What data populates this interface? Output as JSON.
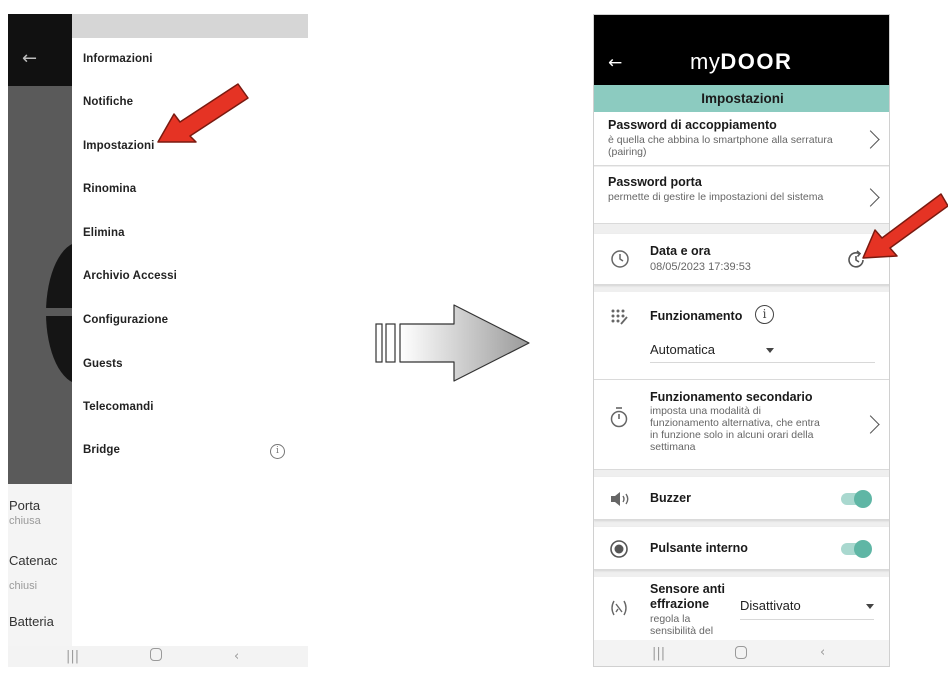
{
  "left_phone": {
    "drawer_items": [
      {
        "label": "Informazioni"
      },
      {
        "label": "Notifiche"
      },
      {
        "label": "Impostazioni"
      },
      {
        "label": "Rinomina"
      },
      {
        "label": "Elimina"
      },
      {
        "label": "Archivio Accessi"
      },
      {
        "label": "Configurazione"
      },
      {
        "label": "Guests"
      },
      {
        "label": "Telecomandi"
      },
      {
        "label": "Bridge"
      }
    ],
    "info_icon": "info-icon",
    "background_status": {
      "porta_label": "Porta",
      "porta_value": "chiusa",
      "catenacci_label": "Catenac",
      "catenacci_value": "chiusi",
      "batteria_label": "Batteria"
    }
  },
  "right_phone": {
    "logo_prefix": "my",
    "logo_main": "DOOR",
    "page_title": "Impostazioni",
    "pairing_password": {
      "title": "Password di accoppiamento",
      "subtitle": "è quella che abbina lo smartphone alla serratura (pairing)"
    },
    "door_password": {
      "title": "Password porta",
      "subtitle": "permette di gestire le impostazioni del sistema"
    },
    "date_time": {
      "title": "Data e ora",
      "value": "08/05/2023 17:39:53"
    },
    "operation": {
      "title": "Funzionamento",
      "selected": "Automatica"
    },
    "secondary_operation": {
      "title": "Funzionamento secondario",
      "subtitle": "imposta una modalità di funzionamento alternativa, che entra in funzione solo in alcuni orari della settimana"
    },
    "buzzer": {
      "title": "Buzzer",
      "enabled": true
    },
    "internal_button": {
      "title": "Pulsante interno",
      "enabled": true
    },
    "tamper_sensor": {
      "title_line1": "Sensore anti",
      "title_line2": "effrazione",
      "subtitle_line1": "regola la",
      "subtitle_line2": "sensibilità del",
      "selected": "Disattivato"
    }
  },
  "colors": {
    "accent_teal": "#8ccbc0",
    "toggle_knob": "#5fb6a5",
    "arrow_red": "#e53324"
  }
}
